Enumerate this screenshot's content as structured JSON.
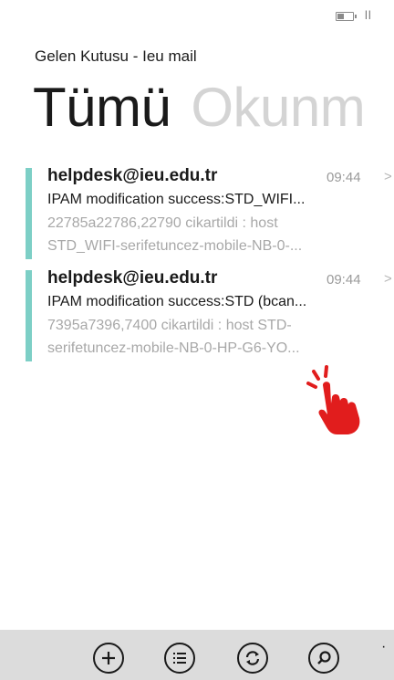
{
  "status_bar": {
    "indicator": "ll"
  },
  "header": {
    "app_title": "Gelen Kutusu - Ieu mail",
    "pivot_active": "Tümü",
    "pivot_inactive": "Okunm"
  },
  "mails": [
    {
      "sender": "helpdesk@ieu.edu.tr",
      "time": "09:44",
      "subject": "IPAM modification success:STD_WIFI...",
      "preview_line1": "22785a22786,22790 cikartildi : host",
      "preview_line2": "STD_WIFI-serifetuncez-mobile-NB-0-..."
    },
    {
      "sender": "helpdesk@ieu.edu.tr",
      "time": "09:44",
      "subject": "IPAM modification success:STD (bcan...",
      "preview_line1": "7395a7396,7400 cikartildi : host STD-",
      "preview_line2": "serifetuncez-mobile-NB-0-HP-G6-YO..."
    }
  ],
  "app_bar": {
    "more": "·",
    "icons": [
      "add-icon",
      "select-list-icon",
      "sync-icon",
      "search-icon"
    ]
  },
  "colors": {
    "unread_accent": "#7dcfc6",
    "app_bar_bg": "#dcdcdc",
    "hand_pointer": "#e11d1d"
  }
}
